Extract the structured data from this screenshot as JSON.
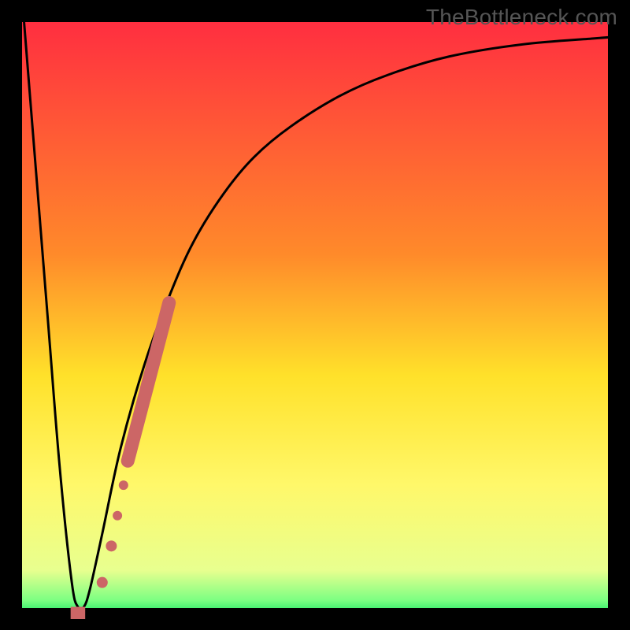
{
  "watermark": "TheBottleneck.com",
  "chart_data": {
    "type": "line",
    "title": "",
    "xlabel": "",
    "ylabel": "",
    "xlim": [
      0,
      100
    ],
    "ylim": [
      0,
      100
    ],
    "grid": false,
    "legend": false,
    "gradient_stops": [
      {
        "offset": 0,
        "color": "#ff2a41"
      },
      {
        "offset": 40,
        "color": "#ff8a2a"
      },
      {
        "offset": 60,
        "color": "#ffe12a"
      },
      {
        "offset": 78,
        "color": "#fff86a"
      },
      {
        "offset": 92,
        "color": "#e8ff8f"
      },
      {
        "offset": 97,
        "color": "#7aff82"
      },
      {
        "offset": 100,
        "color": "#00e15b"
      }
    ],
    "series": [
      {
        "name": "curve",
        "x": [
          2,
          6,
          8,
          10,
          11,
          12,
          13,
          15,
          18,
          22,
          26,
          30,
          35,
          40,
          46,
          54,
          62,
          72,
          84,
          96,
          100
        ],
        "y": [
          100,
          50,
          25,
          6,
          2,
          2,
          5,
          14,
          28,
          42,
          53,
          62,
          70,
          76,
          81,
          86,
          89.5,
          92.5,
          94.5,
          95.5,
          95.8
        ]
      }
    ],
    "valley_bar": {
      "x": 11,
      "width": 2.4,
      "height": 2
    },
    "markers": [
      {
        "x": 15.0,
        "y": 6.0,
        "r": 7
      },
      {
        "x": 16.5,
        "y": 12.0,
        "r": 7
      },
      {
        "x": 17.5,
        "y": 17.0,
        "r": 6
      },
      {
        "x": 18.5,
        "y": 22.0,
        "r": 6
      }
    ],
    "segment": {
      "x1": 19.2,
      "y1": 26.0,
      "x2": 26.0,
      "y2": 52.0,
      "width": 17
    }
  }
}
